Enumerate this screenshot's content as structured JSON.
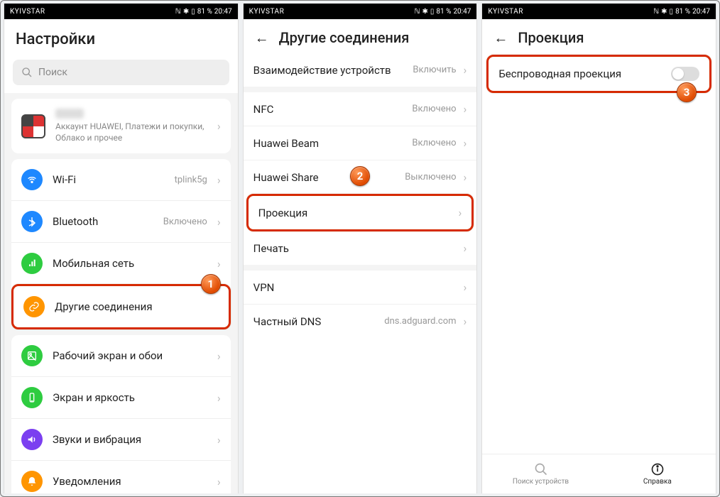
{
  "status": {
    "carrier": "KYIVSTAR",
    "battery": "81 %",
    "time": "20:47"
  },
  "panel1": {
    "title": "Настройки",
    "search_placeholder": "Поиск",
    "account": {
      "name": "",
      "sub": "Аккаунт HUAWEI, Платежи и покупки, Облако и прочее"
    },
    "rows": {
      "wifi": {
        "label": "Wi-Fi",
        "value": "tplink5g"
      },
      "bluetooth": {
        "label": "Bluetooth",
        "value": "Включено"
      },
      "mobile": {
        "label": "Мобильная сеть"
      },
      "other_conn": {
        "label": "Другие соединения"
      },
      "home": {
        "label": "Рабочий экран и обои"
      },
      "display": {
        "label": "Экран и яркость"
      },
      "sounds": {
        "label": "Звуки и вибрация"
      },
      "notif": {
        "label": "Уведомления"
      }
    },
    "callout": "1"
  },
  "panel2": {
    "title": "Другие соединения",
    "rows": {
      "device_interop": {
        "label": "Взаимодействие устройств",
        "value": "Включить"
      },
      "nfc": {
        "label": "NFC",
        "value": "Включено"
      },
      "beam": {
        "label": "Huawei Beam",
        "value": "Включено"
      },
      "share": {
        "label": "Huawei Share",
        "value": "Выключено"
      },
      "projection": {
        "label": "Проекция"
      },
      "print": {
        "label": "Печать"
      },
      "vpn": {
        "label": "VPN"
      },
      "dns": {
        "label": "Частный DNS",
        "value": "dns.adguard.com"
      }
    },
    "callout": "2"
  },
  "panel3": {
    "title": "Проекция",
    "rows": {
      "wireless": {
        "label": "Беспроводная проекция"
      }
    },
    "callout": "3",
    "tabs": {
      "search": "Поиск устройств",
      "help": "Справка"
    }
  }
}
